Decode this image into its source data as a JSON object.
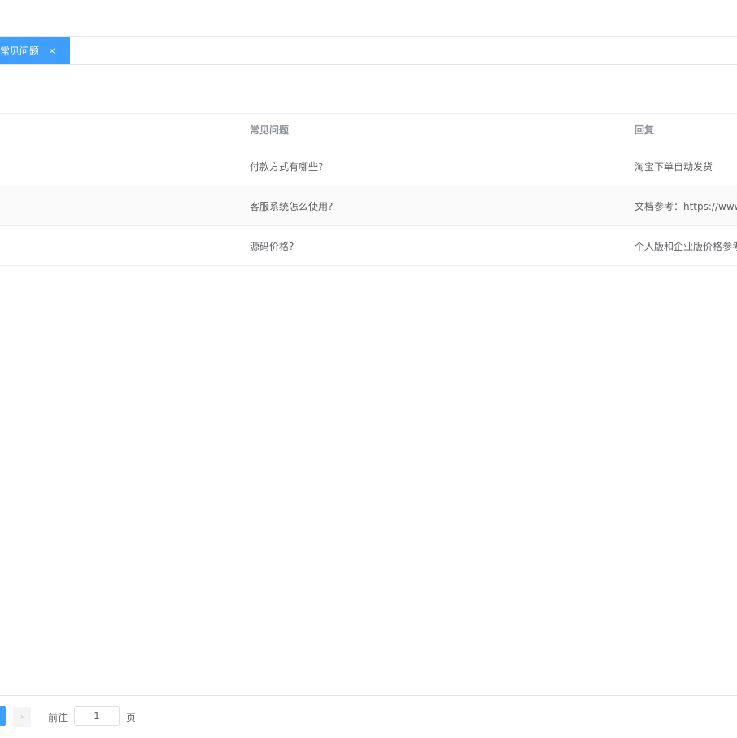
{
  "tabs": [
    {
      "label": "常见问题",
      "close": "×",
      "active": true
    }
  ],
  "table": {
    "headers": {
      "question": "常见问题",
      "answer": "回复"
    },
    "rows": [
      {
        "question": "付款方式有哪些?",
        "answer": "淘宝下单自动发货"
      },
      {
        "question": "客服系统怎么使用?",
        "answer": "文档参考：https://www"
      },
      {
        "question": "源码价格?",
        "answer": "个人版和企业版价格参考"
      }
    ]
  },
  "pagination": {
    "next_icon": "›",
    "goto_label": "前往",
    "page_value": "1",
    "page_suffix": "页"
  },
  "colors": {
    "accent": "#409eff",
    "border": "#ebeef5",
    "stripe": "#fafafa"
  }
}
